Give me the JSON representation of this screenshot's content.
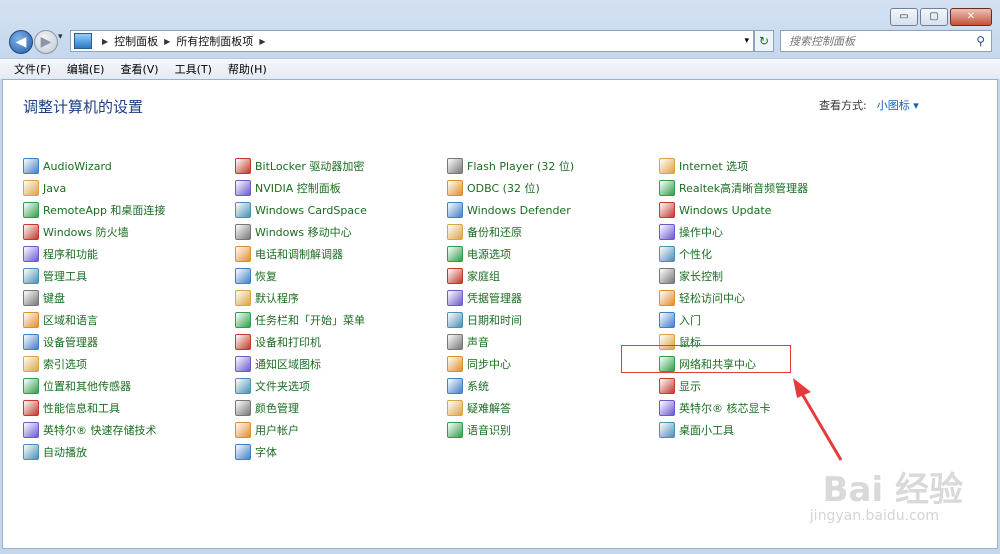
{
  "window": {
    "caption_min": "▭",
    "caption_max": "▢",
    "caption_close": "✕"
  },
  "address": {
    "crumbs": [
      "控制面板",
      "所有控制面板项"
    ],
    "search_placeholder": "搜索控制面板"
  },
  "menu": [
    "文件(F)",
    "编辑(E)",
    "查看(V)",
    "工具(T)",
    "帮助(H)"
  ],
  "header": {
    "title": "调整计算机的设置",
    "view_label": "查看方式:",
    "view_value": "小图标 ▾"
  },
  "columns": [
    [
      "AudioWizard",
      "Java",
      "RemoteApp 和桌面连接",
      "Windows 防火墙",
      "程序和功能",
      "管理工具",
      "键盘",
      "区域和语言",
      "设备管理器",
      "索引选项",
      "位置和其他传感器",
      "性能信息和工具",
      "英特尔® 快速存储技术",
      "自动播放"
    ],
    [
      "BitLocker 驱动器加密",
      "NVIDIA 控制面板",
      "Windows CardSpace",
      "Windows 移动中心",
      "电话和调制解调器",
      "恢复",
      "默认程序",
      "任务栏和「开始」菜单",
      "设备和打印机",
      "通知区域图标",
      "文件夹选项",
      "颜色管理",
      "用户帐户",
      "字体"
    ],
    [
      "Flash Player (32 位)",
      "ODBC (32 位)",
      "Windows Defender",
      "备份和还原",
      "电源选项",
      "家庭组",
      "凭据管理器",
      "日期和时间",
      "声音",
      "同步中心",
      "系统",
      "疑难解答",
      "语音识别"
    ],
    [
      "Internet 选项",
      "Realtek高清晰音频管理器",
      "Windows Update",
      "操作中心",
      "个性化",
      "家长控制",
      "轻松访问中心",
      "入门",
      "鼠标",
      "网络和共享中心",
      "显示",
      "英特尔® 核芯显卡",
      "桌面小工具"
    ]
  ],
  "icon_colors": [
    "#3f7fc9",
    "#d9a441",
    "#2f9d4a",
    "#c0392b",
    "#6a5acd",
    "#4a8fb5",
    "#777777",
    "#e08e2b"
  ],
  "watermark": {
    "text": "Bai 经验",
    "sub": "jingyan.baidu.com"
  },
  "highlight_color": "#e53b3b"
}
